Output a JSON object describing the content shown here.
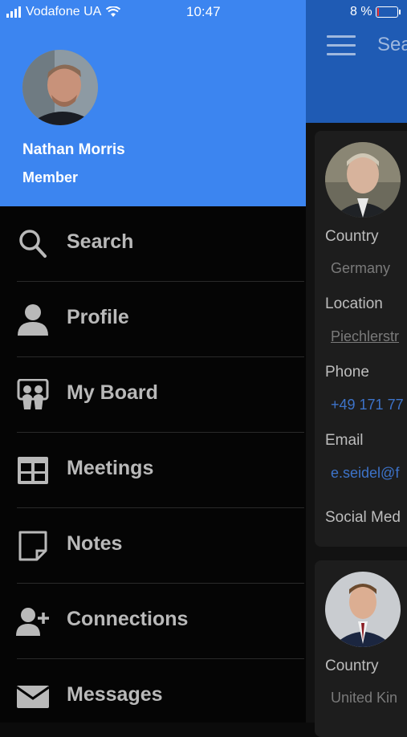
{
  "status_bar": {
    "carrier": "Vodafone UA",
    "time": "10:47",
    "battery": "8 %",
    "battery_level": 0.08
  },
  "background": {
    "header_title": "Sea",
    "cards": [
      {
        "fields": [
          {
            "label": "Country",
            "value": "Germany",
            "style": "plain"
          },
          {
            "label": "Location",
            "value": "Piechlerstr",
            "style": "underline"
          },
          {
            "label": "Phone",
            "value": "+49 171 77",
            "style": "link"
          },
          {
            "label": "Email",
            "value": "e.seidel@f",
            "style": "link"
          },
          {
            "label": "Social Med",
            "value": "",
            "style": "plain"
          }
        ]
      },
      {
        "fields": [
          {
            "label": "Country",
            "value": "United Kin",
            "style": "plain"
          }
        ]
      }
    ]
  },
  "drawer": {
    "user": {
      "name": "Nathan Morris",
      "role": "Member"
    },
    "colors": {
      "header": "#3c85f0",
      "background": "#050505"
    },
    "items": [
      {
        "label": "Search",
        "icon": "search-icon"
      },
      {
        "label": "Profile",
        "icon": "person-icon"
      },
      {
        "label": "My Board",
        "icon": "board-icon"
      },
      {
        "label": "Meetings",
        "icon": "grid-icon"
      },
      {
        "label": "Notes",
        "icon": "note-icon"
      },
      {
        "label": "Connections",
        "icon": "add-person-icon"
      },
      {
        "label": "Messages",
        "icon": "envelope-icon"
      }
    ]
  }
}
